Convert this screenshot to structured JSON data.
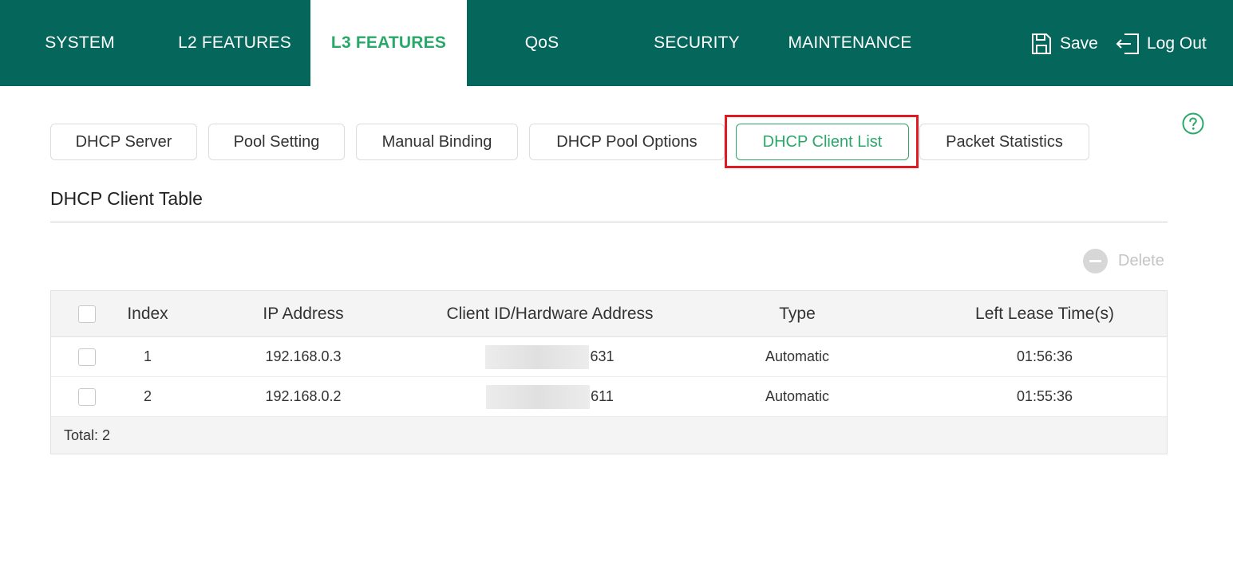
{
  "nav": {
    "items": [
      {
        "label": "SYSTEM"
      },
      {
        "label": "L2 FEATURES"
      },
      {
        "label": "L3 FEATURES",
        "active": true
      },
      {
        "label": "QoS"
      },
      {
        "label": "SECURITY"
      },
      {
        "label": "MAINTENANCE"
      }
    ],
    "save_label": "Save",
    "logout_label": "Log Out"
  },
  "subtabs": [
    {
      "label": "DHCP Server"
    },
    {
      "label": "Pool Setting"
    },
    {
      "label": "Manual Binding"
    },
    {
      "label": "DHCP Pool Options"
    },
    {
      "label": "DHCP Client List",
      "active": true
    },
    {
      "label": "Packet Statistics"
    }
  ],
  "section": {
    "title": "DHCP Client Table"
  },
  "toolbar": {
    "delete_label": "Delete"
  },
  "table": {
    "headers": {
      "index": "Index",
      "ip": "IP Address",
      "client_id": "Client ID/Hardware Address",
      "type": "Type",
      "lease": "Left Lease Time(s)"
    },
    "rows": [
      {
        "index": "1",
        "ip": "192.168.0.3",
        "client_id_visible": "631",
        "type": "Automatic",
        "lease": "01:56:36"
      },
      {
        "index": "2",
        "ip": "192.168.0.2",
        "client_id_visible": "611",
        "type": "Automatic",
        "lease": "01:55:36"
      }
    ],
    "total_label": "Total: 2"
  },
  "colors": {
    "header_bg": "#05675b",
    "accent": "#2aa86a",
    "highlight": "#e01a22"
  },
  "icons": [
    "save-icon",
    "logout-icon",
    "help-icon",
    "minus-circle-icon",
    "checkbox-icon"
  ]
}
